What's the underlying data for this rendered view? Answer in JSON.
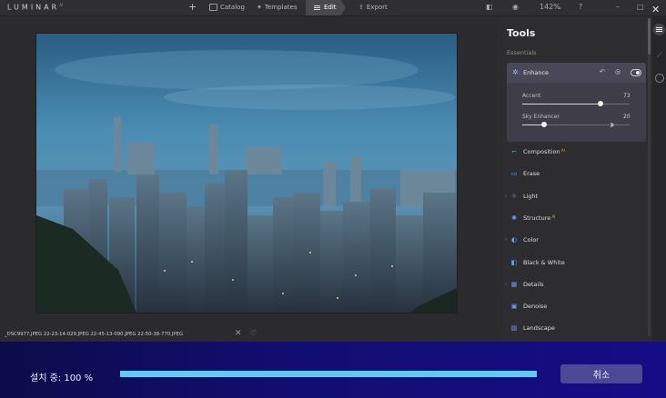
{
  "app": {
    "logo": "LUMINAR",
    "logo_suffix": "AI"
  },
  "nav": {
    "catalog": "Catalog",
    "templates": "Templates",
    "edit": "Edit",
    "export": "Export",
    "zoom": "142%"
  },
  "panel": {
    "title": "Tools",
    "section": "Essentials",
    "enhance": {
      "label": "Enhance",
      "sliders": [
        {
          "label": "Accent",
          "value": "73",
          "level": 0.73
        },
        {
          "label": "Sky Enhancer",
          "value": "20",
          "level": 0.2
        }
      ]
    },
    "tools": [
      {
        "label": "Composition",
        "ai": "AI",
        "icon": "crop-icon"
      },
      {
        "label": "Erase",
        "icon": "eraser-icon"
      },
      {
        "label": "Light",
        "icon": "sun-icon",
        "chevron": true
      },
      {
        "label": "Structure",
        "ai": "AI",
        "icon": "sparkle-icon"
      },
      {
        "label": "Color",
        "icon": "color-drops-icon",
        "chevron": true
      },
      {
        "label": "Black & White",
        "icon": "bw-icon"
      },
      {
        "label": "Details",
        "icon": "details-icon",
        "chevron": true
      },
      {
        "label": "Denoise",
        "icon": "denoise-icon"
      },
      {
        "label": "Landscape",
        "icon": "landscape-icon"
      }
    ]
  },
  "filmstrip": {
    "filename": "_DSC9977.JPEG 22-23-14-029.JPEG 22-45-13-090.JPEG 22-50-38-770.JPEG"
  },
  "installer": {
    "status": "설치 중: 100 %",
    "progress": 1.0,
    "cancel_label": "취소"
  }
}
